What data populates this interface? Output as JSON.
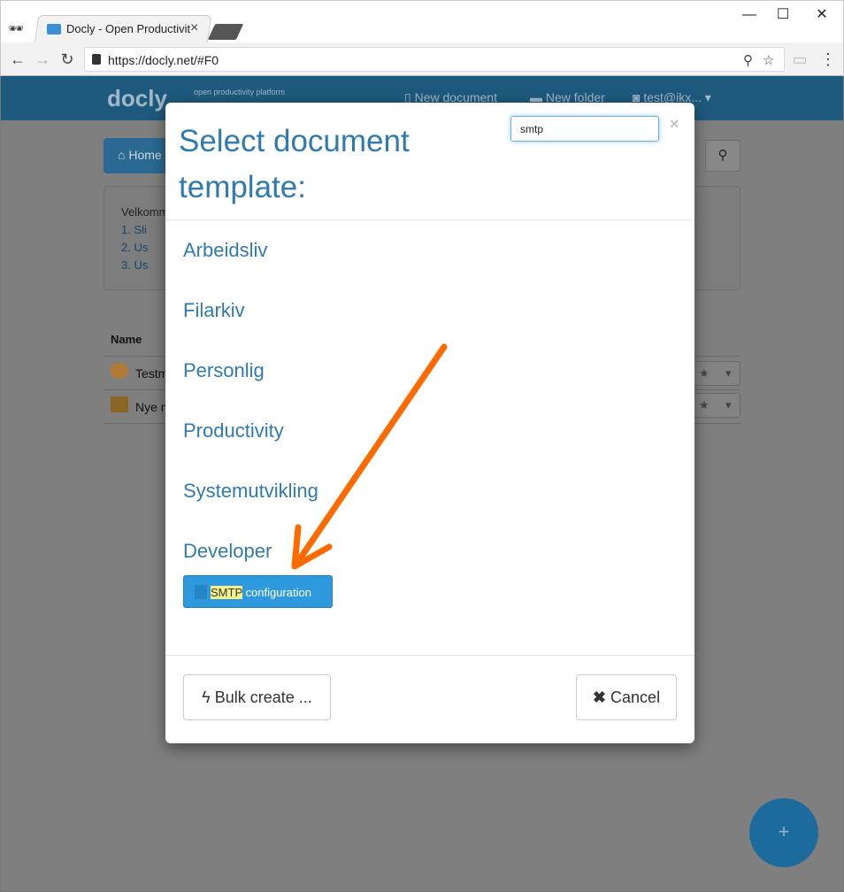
{
  "browser": {
    "tab_title": "Docly - Open Productivity",
    "tab_close": "×",
    "url": "https://docly.net/#F0",
    "window_controls": [
      "—",
      "☐",
      "✕"
    ],
    "nav_icons": [
      "back-icon",
      "forward-icon",
      "reload-icon"
    ]
  },
  "app": {
    "logo": "docly",
    "logo_sub": "open productivity platform",
    "header_links": {
      "new_document": "New document",
      "new_folder": "New folder",
      "user": "test@ikx..."
    },
    "home_label": "Home",
    "welcome_text": "Velkomm",
    "welcome_links": [
      "1. Sli",
      "2. Us",
      "3. Us"
    ],
    "table_header_name": "Name",
    "rows": [
      {
        "name": "Testm",
        "icon": "globe-icon"
      },
      {
        "name": "Nye m",
        "icon": "folder-icon"
      }
    ],
    "fab_label": "+"
  },
  "modal": {
    "title": "Select document template:",
    "search_value": "smtp",
    "close_label": "×",
    "categories": [
      "Arbeidsliv",
      "Filarkiv",
      "Personlig",
      "Productivity",
      "Systemutvikling",
      "Developer"
    ],
    "template_match": "SMTP",
    "template_rest": " configuration",
    "bulk_create_label": "Bulk create ...",
    "cancel_label": "Cancel"
  },
  "colors": {
    "accent": "#2f7ab0",
    "button_primary": "#2f99dd",
    "highlight": "#f3f38a",
    "annotation_arrow": "#ff6a00"
  }
}
